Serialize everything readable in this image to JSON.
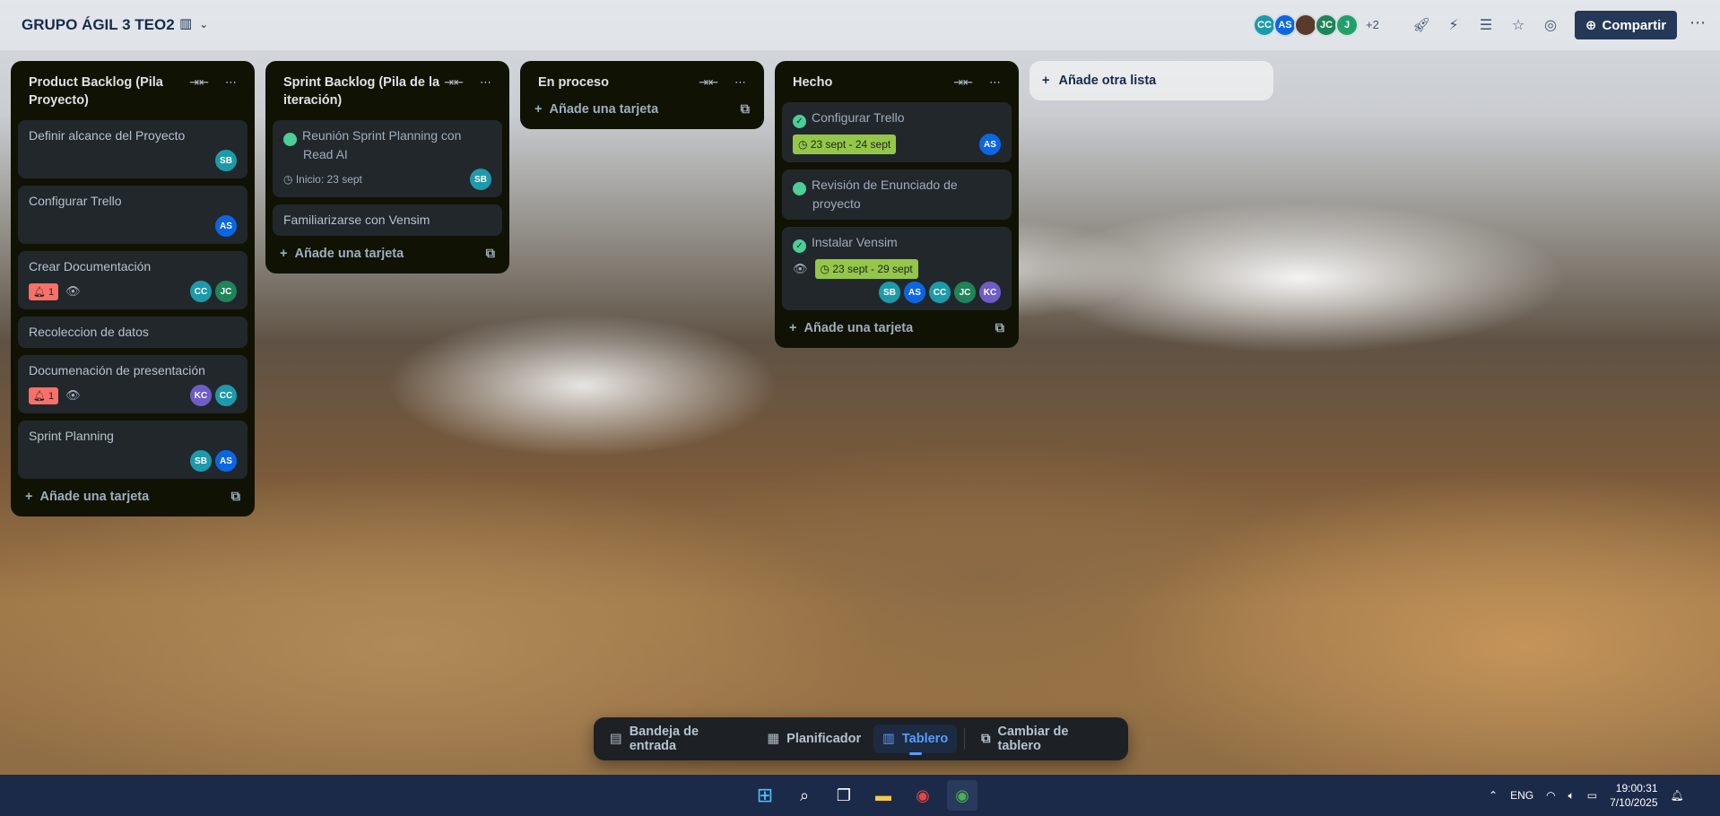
{
  "header": {
    "board_title": "GRUPO ÁGIL 3 TEO2",
    "members": [
      {
        "initials": "CC",
        "color": "#1d9aaa"
      },
      {
        "initials": "AS",
        "color": "#0c66e4"
      },
      {
        "initials": "",
        "color": "#5a3a2a"
      },
      {
        "initials": "JC",
        "color": "#1f845a"
      },
      {
        "initials": "J",
        "color": "#22a06b"
      }
    ],
    "more_members": "+2",
    "share_label": "Compartir"
  },
  "lists": [
    {
      "title": "Product Backlog (Pila Proyecto)",
      "cards": [
        {
          "title": "Definir alcance del Proyecto",
          "members": [
            {
              "initials": "SB",
              "color": "#1d9aaa"
            }
          ]
        },
        {
          "title": "Configurar Trello",
          "members": [
            {
              "initials": "AS",
              "color": "#0c66e4"
            }
          ]
        },
        {
          "title": "Crear Documentación",
          "alert": "1",
          "members": [
            {
              "initials": "CC",
              "color": "#1d9aaa"
            },
            {
              "initials": "JC",
              "color": "#1f845a"
            }
          ]
        },
        {
          "title": "Recoleccion de datos",
          "members": []
        },
        {
          "title": "Documenación de presentación",
          "alert": "1",
          "members": [
            {
              "initials": "KC",
              "color": "#6e5dc6"
            },
            {
              "initials": "CC",
              "color": "#1d9aaa"
            }
          ]
        },
        {
          "title": "Sprint Planning",
          "members": [
            {
              "initials": "SB",
              "color": "#1d9aaa"
            },
            {
              "initials": "AS",
              "color": "#0c66e4"
            }
          ]
        }
      ],
      "add_label": "Añade una tarjeta"
    },
    {
      "title": "Sprint Backlog (Pila de la iteración)",
      "cards": [
        {
          "title": "Reunión Sprint Planning con Read AI",
          "done": true,
          "date": "Inicio: 23 sept",
          "members": [
            {
              "initials": "SB",
              "color": "#1d9aaa"
            }
          ]
        },
        {
          "title": "Familiarizarse con Vensim",
          "members": []
        }
      ],
      "add_label": "Añade una tarjeta"
    },
    {
      "title": "En proceso",
      "cards": [],
      "add_label": "Añade una tarjeta"
    },
    {
      "title": "Hecho",
      "cards": [
        {
          "title": "Configurar Trello",
          "done": true,
          "date_badge": "23 sept - 24 sept",
          "members": [
            {
              "initials": "AS",
              "color": "#0c66e4"
            }
          ]
        },
        {
          "title": "Revisión de Enunciado de proyecto",
          "done": true,
          "members": []
        },
        {
          "title": "Instalar Vensim",
          "done": true,
          "date_badge": "23 sept - 29 sept",
          "members": [
            {
              "initials": "SB",
              "color": "#1d9aaa"
            },
            {
              "initials": "AS",
              "color": "#0c66e4"
            },
            {
              "initials": "CC",
              "color": "#1d9aaa"
            },
            {
              "initials": "JC",
              "color": "#1f845a"
            },
            {
              "initials": "KC",
              "color": "#6e5dc6"
            }
          ]
        }
      ],
      "add_label": "Añade una tarjeta"
    }
  ],
  "add_list_label": "Añade otra lista",
  "bottom_nav": {
    "inbox": "Bandeja de entrada",
    "planner": "Planificador",
    "board": "Tablero",
    "switch": "Cambiar de tablero"
  },
  "taskbar": {
    "lang": "ENG",
    "time": "19:00:31",
    "date": "7/10/2025"
  }
}
